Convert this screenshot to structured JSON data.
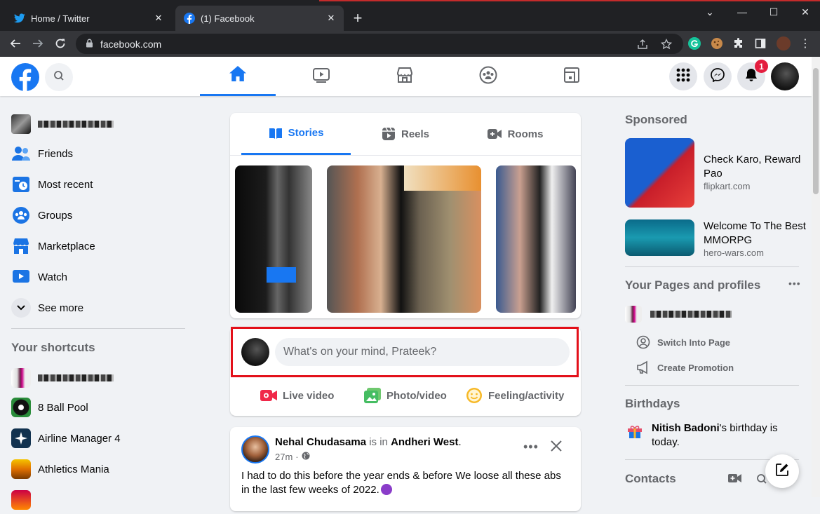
{
  "browser": {
    "tabs": [
      {
        "title": "Home / Twitter",
        "icon": "twitter-icon",
        "active": false
      },
      {
        "title": "(1) Facebook",
        "icon": "facebook-icon",
        "active": true
      }
    ],
    "url": "facebook.com"
  },
  "header": {
    "notification_count": "1",
    "nav_icons": [
      "home-icon",
      "watch-icon",
      "marketplace-icon",
      "groups-icon",
      "gaming-icon"
    ]
  },
  "left_nav": {
    "items": [
      {
        "label": "Friends",
        "icon": "friends-icon"
      },
      {
        "label": "Most recent",
        "icon": "most-recent-icon"
      },
      {
        "label": "Groups",
        "icon": "groups-icon"
      },
      {
        "label": "Marketplace",
        "icon": "marketplace-icon"
      },
      {
        "label": "Watch",
        "icon": "watch-icon"
      },
      {
        "label": "See more",
        "icon": "chevron-down-icon"
      }
    ],
    "shortcuts_heading": "Your shortcuts",
    "shortcuts": [
      {
        "label": "8 Ball Pool"
      },
      {
        "label": "Airline Manager 4"
      },
      {
        "label": "Athletics Mania"
      }
    ]
  },
  "stories": {
    "tabs": [
      "Stories",
      "Reels",
      "Rooms"
    ]
  },
  "composer": {
    "placeholder": "What's on your mind, Prateek?",
    "actions": [
      "Live video",
      "Photo/video",
      "Feeling/activity"
    ]
  },
  "post": {
    "author": "Nehal Chudasama",
    "is_in": " is in ",
    "location": "Andheri West",
    "time": "27m",
    "text": "I had to do this before the year ends & before We loose all these abs in the last few weeks of 2022."
  },
  "sidebar": {
    "sponsored_heading": "Sponsored",
    "ads": [
      {
        "title": "Check Karo, Reward Pao",
        "url": "flipkart.com"
      },
      {
        "title": "Welcome To The Best MMORPG",
        "url": "hero-wars.com"
      }
    ],
    "pages_heading": "Your Pages and profiles",
    "page_actions": [
      "Switch Into Page",
      "Create Promotion"
    ],
    "birthdays_heading": "Birthdays",
    "birthday_name": "Nitish Badoni",
    "birthday_text": "'s birthday is today.",
    "contacts_heading": "Contacts"
  },
  "colors": {
    "accent": "#1877f2",
    "highlight": "#e3101a"
  }
}
